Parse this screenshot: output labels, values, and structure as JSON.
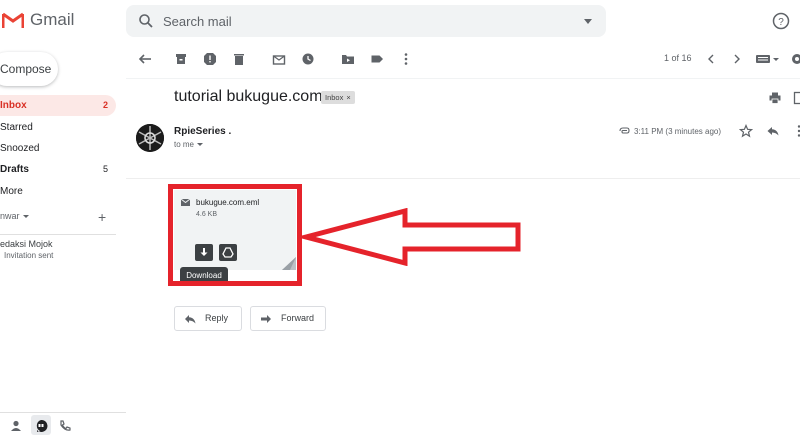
{
  "app": {
    "name": "Gmail"
  },
  "search": {
    "placeholder": "Search mail"
  },
  "sidebar": {
    "compose_label": "Compose",
    "items": [
      {
        "label": "Inbox",
        "count": "2",
        "active": true
      },
      {
        "label": "Starred",
        "count": ""
      },
      {
        "label": "Snoozed",
        "count": ""
      },
      {
        "label": "Drafts",
        "count": "5"
      },
      {
        "label": "More",
        "count": ""
      }
    ],
    "hangouts_user": "nwar",
    "contact": {
      "name": "edaksi Mojok",
      "status": "Invitation sent"
    }
  },
  "toolbar": {
    "pager": "1 of 16"
  },
  "email": {
    "subject": "tutorial bukugue.com",
    "label_chip": "Inbox",
    "label_chip_close": "×",
    "sender": "RpieSeries .",
    "recipient": "to me",
    "timestamp": "3:11 PM (3 minutes ago)"
  },
  "attachment": {
    "filename": "bukugue.com.eml",
    "size": "4.6 KB",
    "tooltip": "Download"
  },
  "actions": {
    "reply": "Reply",
    "forward": "Forward"
  },
  "colors": {
    "highlight": "#e5232b",
    "active_nav_bg": "#fce8e6",
    "active_nav_text": "#d93025"
  }
}
